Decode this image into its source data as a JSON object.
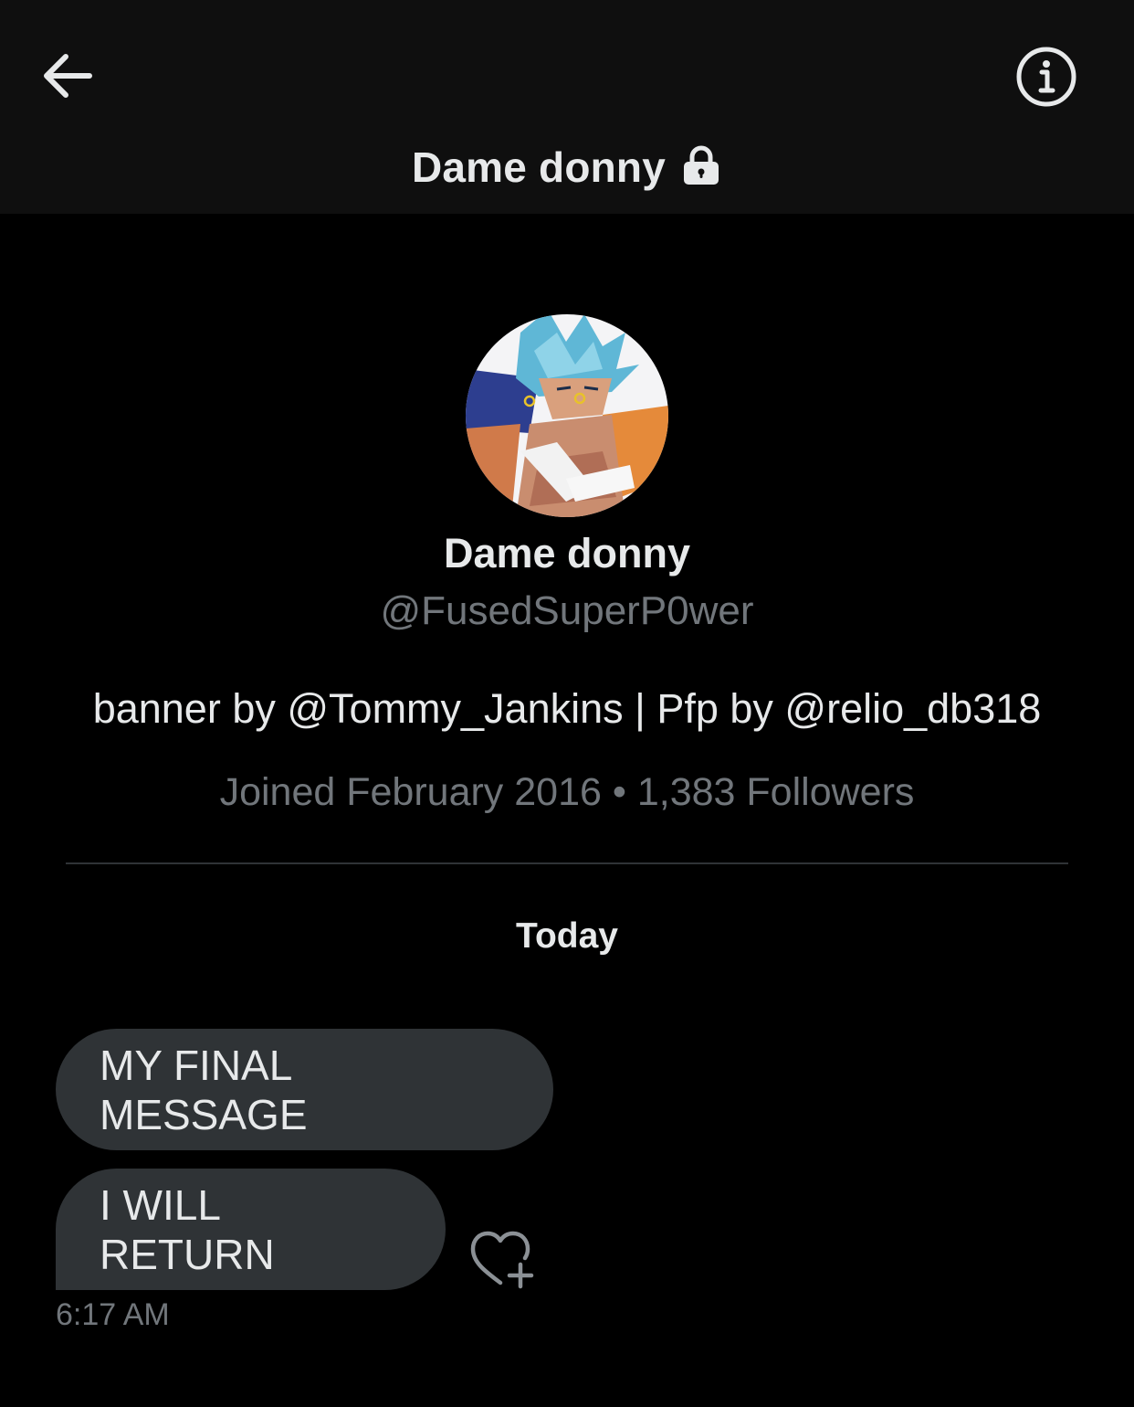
{
  "header": {
    "title": "Dame donny",
    "back_icon": "arrow-left-icon",
    "info_icon": "info-circle-icon",
    "lock_icon": "lock-icon",
    "background": "#0f0f0f"
  },
  "profile": {
    "name": "Dame donny",
    "handle": "@FusedSuperP0wer",
    "bio": "banner by @Tommy_Jankins | Pfp by @relio_db318",
    "meta": "Joined February 2016 • 1,383 Followers",
    "avatar_description": "anime character with blue spiky hair, arms crossed"
  },
  "conversation": {
    "date_separator": "Today",
    "messages": [
      {
        "text": "MY FINAL MESSAGE"
      },
      {
        "text": "I WILL RETURN"
      }
    ],
    "timestamp": "6:17 AM",
    "reaction_icon": "heart-plus-icon"
  },
  "colors": {
    "background": "#000000",
    "primary_text": "#e7e9ea",
    "secondary_text": "#71767b",
    "bubble": "#2f3336",
    "divider": "#2f3336"
  }
}
